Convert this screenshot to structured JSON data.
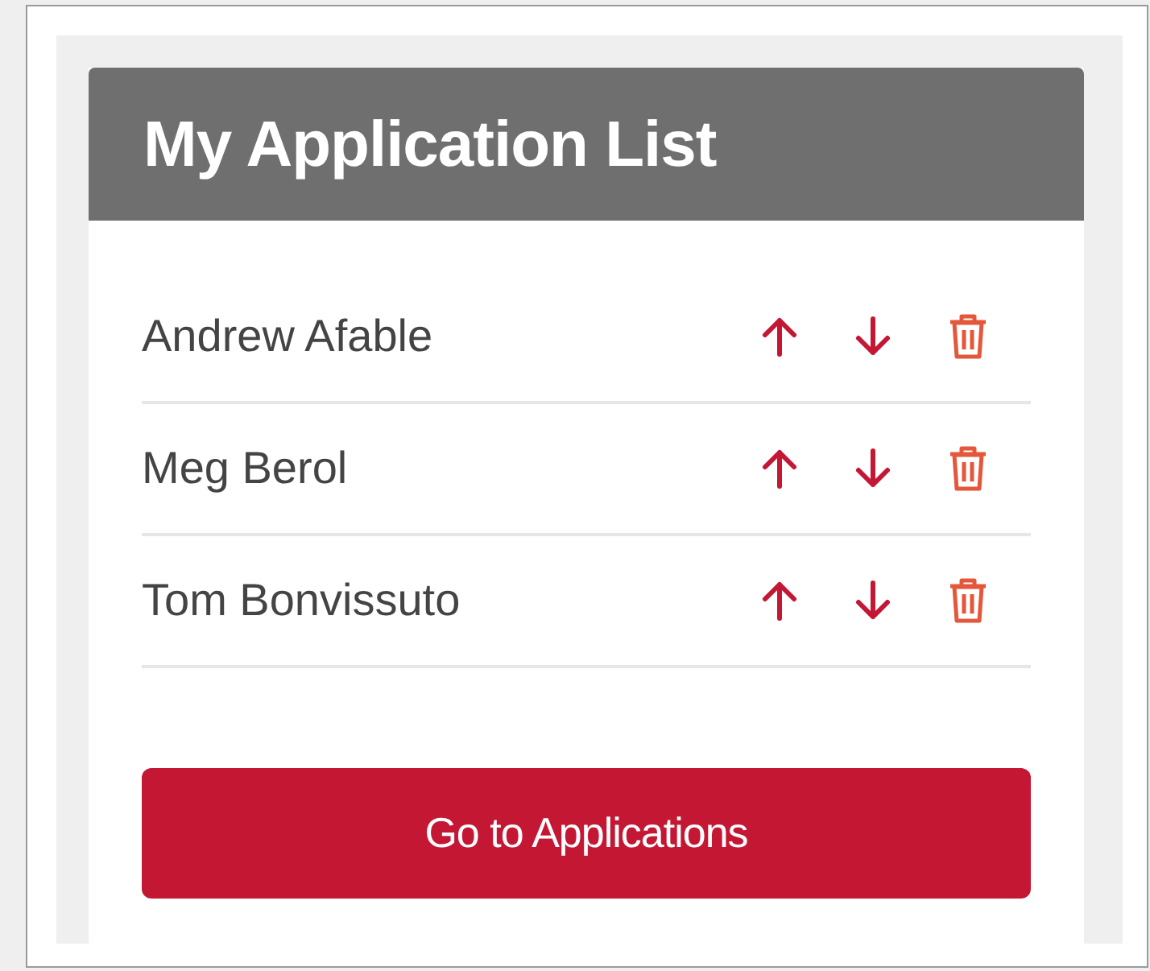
{
  "card": {
    "title": "My Application List"
  },
  "applications": [
    {
      "name": "Andrew Afable"
    },
    {
      "name": "Meg Berol"
    },
    {
      "name": "Tom Bonvissuto"
    }
  ],
  "button": {
    "label": "Go to Applications"
  }
}
